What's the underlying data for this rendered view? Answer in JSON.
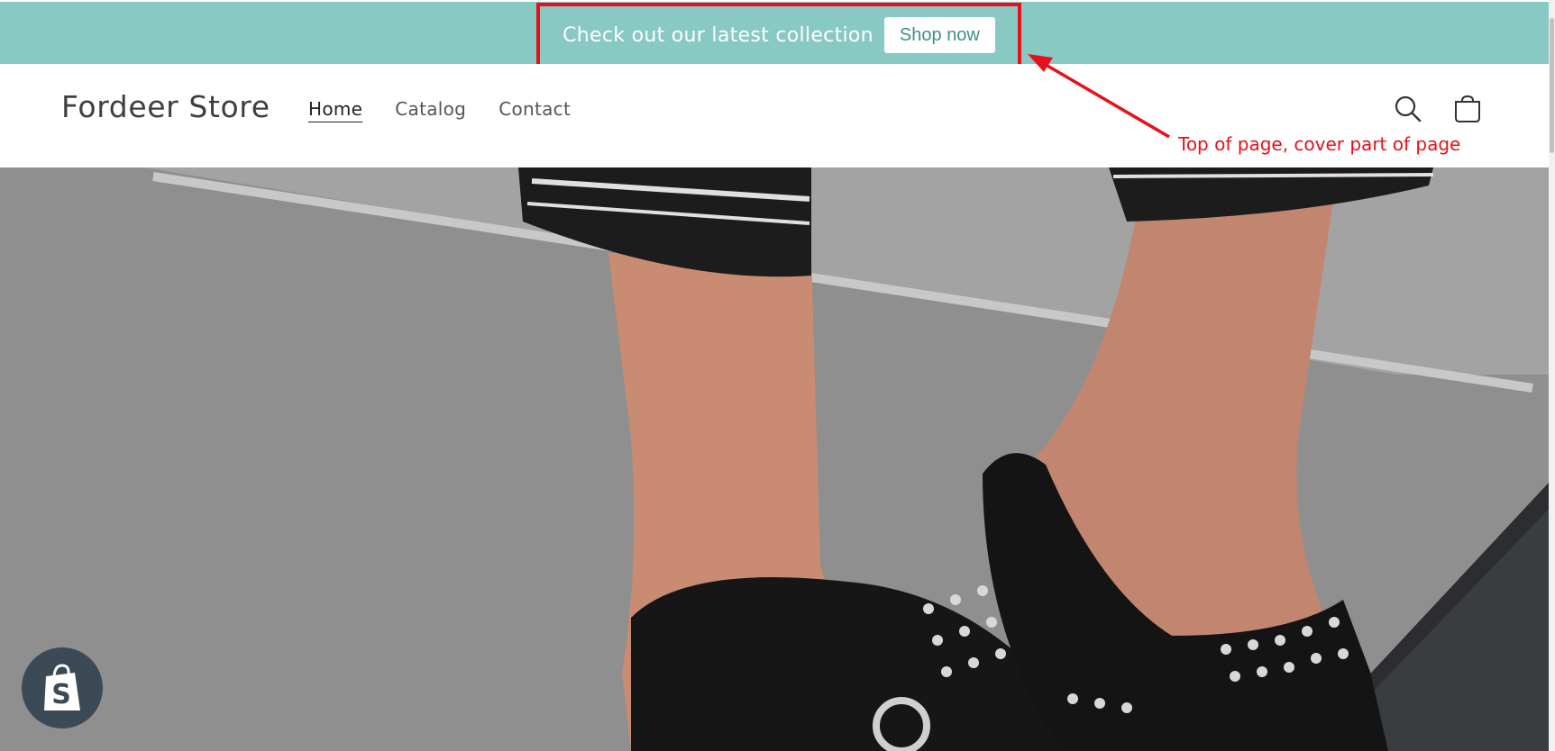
{
  "announcement": {
    "text": "Check out our latest collection",
    "button_label": "Shop now"
  },
  "header": {
    "logo": "Fordeer Store",
    "nav": [
      {
        "label": "Home",
        "active": true
      },
      {
        "label": "Catalog",
        "active": false
      },
      {
        "label": "Contact",
        "active": false
      }
    ],
    "icons": {
      "search": "search-icon",
      "cart": "cart-icon"
    }
  },
  "annotation": {
    "text": "Top of page, cover part of page",
    "color": "#e8101a"
  },
  "badge": {
    "icon": "shopify-bag-icon"
  },
  "colors": {
    "announcement_bg": "#88c9c3",
    "button_text": "#3e8f88",
    "highlight": "#e8101a"
  }
}
